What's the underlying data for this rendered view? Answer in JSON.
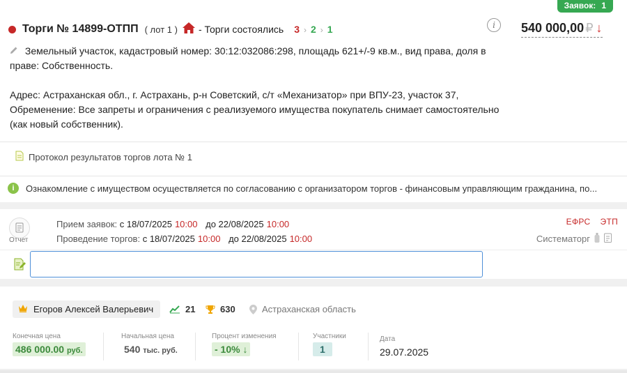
{
  "badge": {
    "label": "Заявок:",
    "count": "1"
  },
  "header": {
    "title": "Торги № 14899-ОТПП",
    "lot": "( лот 1 )",
    "status": "- Торги состоялись",
    "steps": [
      "3",
      "2",
      "1"
    ],
    "price": "540 000,00",
    "currency": "₽",
    "trend": "↓"
  },
  "description": {
    "line1": "Земельный участок, кадастровый номер: 30:12:032086:298, площадь 621+/-9 кв.м., вид права, доля в праве: Собственность.",
    "line2": "Адрес: Астраханская обл., г. Астрахань, р-н Советский, с/т «Механизатор» при ВПУ-23, участок 37, Обременение: Все запреты и ограничения с реализуемого имущества покупатель снимает самостоятельно (как новый собственник)."
  },
  "protocol": "Протокол результатов торгов лота № 1",
  "notice": "Ознакомление с имуществом осуществляется по согласованию с организатором торгов - финансовым управляющим гражданина, по...",
  "schedule": {
    "report_label": "Отчет",
    "accept_label": "Прием заявок:",
    "accept_from": "с 18/07/2025",
    "accept_from_time": "10:00",
    "accept_to": "до 22/08/2025",
    "accept_to_time": "10:00",
    "hold_label": "Проведение торгов:",
    "hold_from": "с 18/07/2025",
    "hold_from_time": "10:00",
    "hold_to": "до 22/08/2025",
    "hold_to_time": "10:00",
    "platforms": [
      "ЕФРС",
      "ЭТП"
    ],
    "operator": "Систематорг"
  },
  "comment": {
    "value": "",
    "placeholder": ""
  },
  "winner": {
    "name": "Егоров Алексей Валерьевич",
    "stat1": "21",
    "stat2": "630",
    "region": "Астраханская область"
  },
  "metrics": {
    "final_label": "Конечная цена",
    "final_value": "486 000.00",
    "final_unit": "руб.",
    "start_label": "Начальная цена",
    "start_value": "540",
    "start_unit": "тыс. руб.",
    "pct_label": "Процент изменения",
    "pct_value": "- 10%",
    "pct_arrow": "↓",
    "part_label": "Участники",
    "part_value": "1",
    "date_label": "Дата",
    "date_value": "29.07.2025"
  },
  "colors": {
    "accent_green": "#36a852",
    "accent_red": "#c62828",
    "input_border": "#4d8fd8"
  }
}
